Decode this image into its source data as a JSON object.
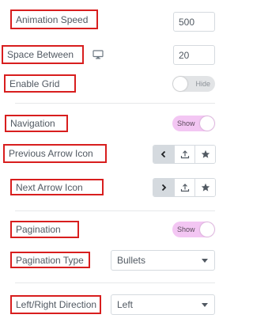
{
  "controls": {
    "animation_speed": {
      "label": "Animation Speed",
      "value": "500"
    },
    "space_between": {
      "label": "Space Between",
      "value": "20",
      "icon": "desktop-monitor-icon"
    },
    "enable_grid": {
      "label": "Enable Grid",
      "toggle_text": "Hide",
      "state": "off"
    },
    "navigation": {
      "label": "Navigation",
      "toggle_text": "Show",
      "state": "on"
    },
    "previous_arrow_icon": {
      "label": "Previous Arrow Icon",
      "icons": [
        "chevron-left-icon",
        "upload-icon",
        "star-icon"
      ],
      "selected": 0
    },
    "next_arrow_icon": {
      "label": "Next Arrow Icon",
      "icons": [
        "chevron-right-icon",
        "upload-icon",
        "star-icon"
      ],
      "selected": 0
    },
    "pagination": {
      "label": "Pagination",
      "toggle_text": "Show",
      "state": "on"
    },
    "pagination_type": {
      "label": "Pagination Type",
      "selected": "Bullets"
    },
    "left_right_direction": {
      "label": "Left/Right Direction",
      "selected": "Left"
    }
  },
  "colors": {
    "highlight_border": "#d81e1e",
    "toggle_on": "#f3c6f3",
    "toggle_off": "#e2e4e6",
    "text": "#515962"
  }
}
